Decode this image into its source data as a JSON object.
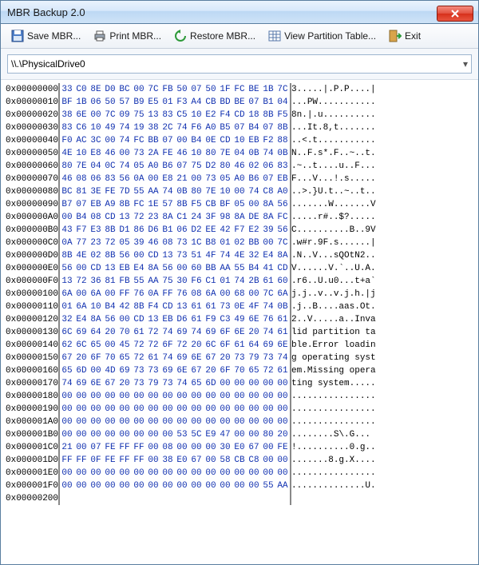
{
  "window": {
    "title": "MBR Backup 2.0"
  },
  "toolbar": {
    "save": {
      "label": "Save MBR...",
      "icon": "floppy-icon"
    },
    "print": {
      "label": "Print MBR...",
      "icon": "printer-icon"
    },
    "restore": {
      "label": "Restore MBR...",
      "icon": "restore-icon"
    },
    "view": {
      "label": "View Partition Table...",
      "icon": "table-icon"
    },
    "exit": {
      "label": "Exit",
      "icon": "exit-icon"
    }
  },
  "drive": {
    "selected": "\\\\.\\PhysicalDrive0"
  },
  "hex": {
    "rows": [
      {
        "addr": "0x00000000",
        "bytes": [
          "33",
          "C0",
          "8E",
          "D0",
          "BC",
          "00",
          "7C",
          "FB",
          "50",
          "07",
          "50",
          "1F",
          "FC",
          "BE",
          "1B",
          "7C"
        ],
        "ascii": "3.....|.P.P....|"
      },
      {
        "addr": "0x00000010",
        "bytes": [
          "BF",
          "1B",
          "06",
          "50",
          "57",
          "B9",
          "E5",
          "01",
          "F3",
          "A4",
          "CB",
          "BD",
          "BE",
          "07",
          "B1",
          "04"
        ],
        "ascii": "...PW..........."
      },
      {
        "addr": "0x00000020",
        "bytes": [
          "38",
          "6E",
          "00",
          "7C",
          "09",
          "75",
          "13",
          "83",
          "C5",
          "10",
          "E2",
          "F4",
          "CD",
          "18",
          "8B",
          "F5"
        ],
        "ascii": "8n.|.u.........."
      },
      {
        "addr": "0x00000030",
        "bytes": [
          "83",
          "C6",
          "10",
          "49",
          "74",
          "19",
          "38",
          "2C",
          "74",
          "F6",
          "A0",
          "B5",
          "07",
          "B4",
          "07",
          "8B"
        ],
        "ascii": "...It.8,t......."
      },
      {
        "addr": "0x00000040",
        "bytes": [
          "F0",
          "AC",
          "3C",
          "00",
          "74",
          "FC",
          "BB",
          "07",
          "00",
          "B4",
          "0E",
          "CD",
          "10",
          "EB",
          "F2",
          "88"
        ],
        "ascii": "..<.t..........."
      },
      {
        "addr": "0x00000050",
        "bytes": [
          "4E",
          "10",
          "E8",
          "46",
          "00",
          "73",
          "2A",
          "FE",
          "46",
          "10",
          "80",
          "7E",
          "04",
          "0B",
          "74",
          "0B"
        ],
        "ascii": "N..F.s*.F..~..t."
      },
      {
        "addr": "0x00000060",
        "bytes": [
          "80",
          "7E",
          "04",
          "0C",
          "74",
          "05",
          "A0",
          "B6",
          "07",
          "75",
          "D2",
          "80",
          "46",
          "02",
          "06",
          "83"
        ],
        "ascii": ".~..t....u..F..."
      },
      {
        "addr": "0x00000070",
        "bytes": [
          "46",
          "08",
          "06",
          "83",
          "56",
          "0A",
          "00",
          "E8",
          "21",
          "00",
          "73",
          "05",
          "A0",
          "B6",
          "07",
          "EB"
        ],
        "ascii": "F...V...!.s....."
      },
      {
        "addr": "0x00000080",
        "bytes": [
          "BC",
          "81",
          "3E",
          "FE",
          "7D",
          "55",
          "AA",
          "74",
          "0B",
          "80",
          "7E",
          "10",
          "00",
          "74",
          "C8",
          "A0"
        ],
        "ascii": "..>.}U.t..~..t.."
      },
      {
        "addr": "0x00000090",
        "bytes": [
          "B7",
          "07",
          "EB",
          "A9",
          "8B",
          "FC",
          "1E",
          "57",
          "8B",
          "F5",
          "CB",
          "BF",
          "05",
          "00",
          "8A",
          "56"
        ],
        "ascii": ".......W.......V"
      },
      {
        "addr": "0x000000A0",
        "bytes": [
          "00",
          "B4",
          "08",
          "CD",
          "13",
          "72",
          "23",
          "8A",
          "C1",
          "24",
          "3F",
          "98",
          "8A",
          "DE",
          "8A",
          "FC"
        ],
        "ascii": ".....r#..$?....."
      },
      {
        "addr": "0x000000B0",
        "bytes": [
          "43",
          "F7",
          "E3",
          "8B",
          "D1",
          "86",
          "D6",
          "B1",
          "06",
          "D2",
          "EE",
          "42",
          "F7",
          "E2",
          "39",
          "56"
        ],
        "ascii": "C..........B..9V"
      },
      {
        "addr": "0x000000C0",
        "bytes": [
          "0A",
          "77",
          "23",
          "72",
          "05",
          "39",
          "46",
          "08",
          "73",
          "1C",
          "B8",
          "01",
          "02",
          "BB",
          "00",
          "7C"
        ],
        "ascii": ".w#r.9F.s......|"
      },
      {
        "addr": "0x000000D0",
        "bytes": [
          "8B",
          "4E",
          "02",
          "8B",
          "56",
          "00",
          "CD",
          "13",
          "73",
          "51",
          "4F",
          "74",
          "4E",
          "32",
          "E4",
          "8A"
        ],
        "ascii": ".N..V...sQOtN2.."
      },
      {
        "addr": "0x000000E0",
        "bytes": [
          "56",
          "00",
          "CD",
          "13",
          "EB",
          "E4",
          "8A",
          "56",
          "00",
          "60",
          "BB",
          "AA",
          "55",
          "B4",
          "41",
          "CD"
        ],
        "ascii": "V......V.`..U.A."
      },
      {
        "addr": "0x000000F0",
        "bytes": [
          "13",
          "72",
          "36",
          "81",
          "FB",
          "55",
          "AA",
          "75",
          "30",
          "F6",
          "C1",
          "01",
          "74",
          "2B",
          "61",
          "60"
        ],
        "ascii": ".r6..U.u0...t+a`"
      },
      {
        "addr": "0x00000100",
        "bytes": [
          "6A",
          "00",
          "6A",
          "00",
          "FF",
          "76",
          "0A",
          "FF",
          "76",
          "08",
          "6A",
          "00",
          "68",
          "00",
          "7C",
          "6A"
        ],
        "ascii": "j.j..v..v.j.h.|j"
      },
      {
        "addr": "0x00000110",
        "bytes": [
          "01",
          "6A",
          "10",
          "B4",
          "42",
          "8B",
          "F4",
          "CD",
          "13",
          "61",
          "61",
          "73",
          "0E",
          "4F",
          "74",
          "0B"
        ],
        "ascii": ".j..B....aas.Ot."
      },
      {
        "addr": "0x00000120",
        "bytes": [
          "32",
          "E4",
          "8A",
          "56",
          "00",
          "CD",
          "13",
          "EB",
          "D6",
          "61",
          "F9",
          "C3",
          "49",
          "6E",
          "76",
          "61"
        ],
        "ascii": "2..V.....a..Inva"
      },
      {
        "addr": "0x00000130",
        "bytes": [
          "6C",
          "69",
          "64",
          "20",
          "70",
          "61",
          "72",
          "74",
          "69",
          "74",
          "69",
          "6F",
          "6E",
          "20",
          "74",
          "61"
        ],
        "ascii": "lid partition ta"
      },
      {
        "addr": "0x00000140",
        "bytes": [
          "62",
          "6C",
          "65",
          "00",
          "45",
          "72",
          "72",
          "6F",
          "72",
          "20",
          "6C",
          "6F",
          "61",
          "64",
          "69",
          "6E"
        ],
        "ascii": "ble.Error loadin"
      },
      {
        "addr": "0x00000150",
        "bytes": [
          "67",
          "20",
          "6F",
          "70",
          "65",
          "72",
          "61",
          "74",
          "69",
          "6E",
          "67",
          "20",
          "73",
          "79",
          "73",
          "74"
        ],
        "ascii": "g operating syst"
      },
      {
        "addr": "0x00000160",
        "bytes": [
          "65",
          "6D",
          "00",
          "4D",
          "69",
          "73",
          "73",
          "69",
          "6E",
          "67",
          "20",
          "6F",
          "70",
          "65",
          "72",
          "61"
        ],
        "ascii": "em.Missing opera"
      },
      {
        "addr": "0x00000170",
        "bytes": [
          "74",
          "69",
          "6E",
          "67",
          "20",
          "73",
          "79",
          "73",
          "74",
          "65",
          "6D",
          "00",
          "00",
          "00",
          "00",
          "00"
        ],
        "ascii": "ting system....."
      },
      {
        "addr": "0x00000180",
        "bytes": [
          "00",
          "00",
          "00",
          "00",
          "00",
          "00",
          "00",
          "00",
          "00",
          "00",
          "00",
          "00",
          "00",
          "00",
          "00",
          "00"
        ],
        "ascii": "................"
      },
      {
        "addr": "0x00000190",
        "bytes": [
          "00",
          "00",
          "00",
          "00",
          "00",
          "00",
          "00",
          "00",
          "00",
          "00",
          "00",
          "00",
          "00",
          "00",
          "00",
          "00"
        ],
        "ascii": "................"
      },
      {
        "addr": "0x000001A0",
        "bytes": [
          "00",
          "00",
          "00",
          "00",
          "00",
          "00",
          "00",
          "00",
          "00",
          "00",
          "00",
          "00",
          "00",
          "00",
          "00",
          "00"
        ],
        "ascii": "................"
      },
      {
        "addr": "0x000001B0",
        "bytes": [
          "00",
          "00",
          "00",
          "00",
          "00",
          "00",
          "00",
          "00",
          "53",
          "5C",
          "E9",
          "47",
          "00",
          "00",
          "80",
          "20"
        ],
        "ascii": "........S\\.G... "
      },
      {
        "addr": "0x000001C0",
        "bytes": [
          "21",
          "00",
          "07",
          "FE",
          "FF",
          "FF",
          "00",
          "08",
          "00",
          "00",
          "00",
          "30",
          "E0",
          "67",
          "00",
          "FE"
        ],
        "ascii": "!..........0.g.."
      },
      {
        "addr": "0x000001D0",
        "bytes": [
          "FF",
          "FF",
          "0F",
          "FE",
          "FF",
          "FF",
          "00",
          "38",
          "E0",
          "67",
          "00",
          "58",
          "CB",
          "C8",
          "00",
          "00"
        ],
        "ascii": ".......8.g.X...."
      },
      {
        "addr": "0x000001E0",
        "bytes": [
          "00",
          "00",
          "00",
          "00",
          "00",
          "00",
          "00",
          "00",
          "00",
          "00",
          "00",
          "00",
          "00",
          "00",
          "00",
          "00"
        ],
        "ascii": "................"
      },
      {
        "addr": "0x000001F0",
        "bytes": [
          "00",
          "00",
          "00",
          "00",
          "00",
          "00",
          "00",
          "00",
          "00",
          "00",
          "00",
          "00",
          "00",
          "00",
          "55",
          "AA"
        ],
        "ascii": "..............U."
      },
      {
        "addr": "0x00000200",
        "bytes": [],
        "ascii": ""
      }
    ]
  }
}
